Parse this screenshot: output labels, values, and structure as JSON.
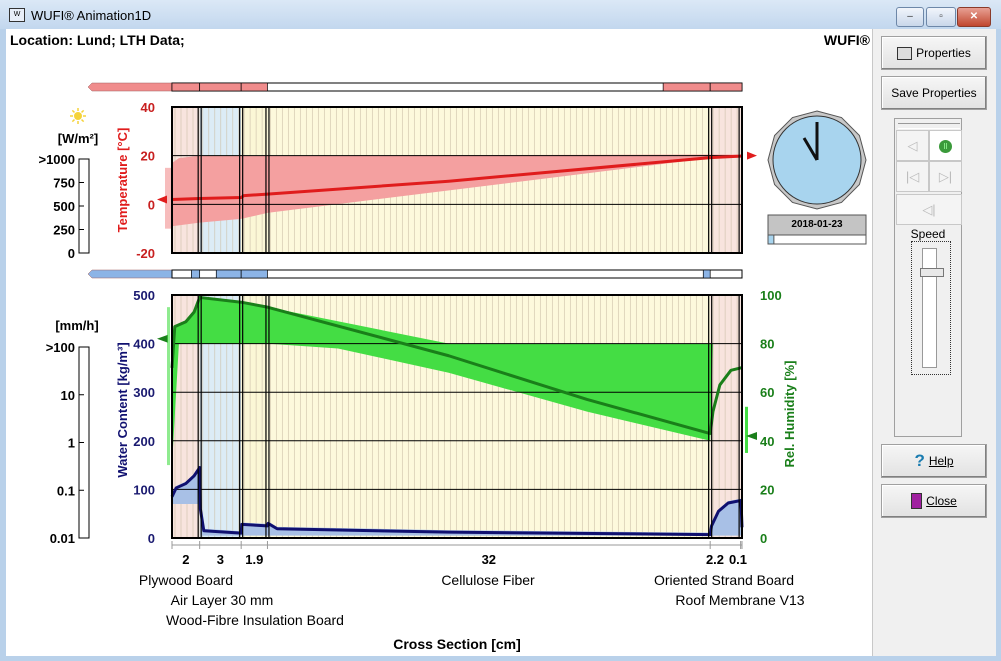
{
  "window": {
    "title": "WUFI® Animation1D",
    "icon": "wufi-app-icon",
    "minimize": "–",
    "maximize": "▫",
    "close": "✕"
  },
  "header": {
    "location": "Location: Lund; LTH Data;",
    "brand": "WUFI®"
  },
  "panel": {
    "properties": "Properties",
    "save_properties": "Save Properties",
    "speed_label": "Speed",
    "help": "Help",
    "close": "Close",
    "speed_level": 0.2,
    "playing": true
  },
  "clock": {
    "date": "2018-01-23",
    "hour_hand_time": "11:59",
    "progress": 0.06
  },
  "left_scales": {
    "radiation": {
      "unit": "[W/m²]",
      "ticks": [
        ">1000",
        "750",
        "500",
        "250",
        "0"
      ],
      "icon": "sun-icon",
      "value": 0
    },
    "rain": {
      "unit": "[mm/h]",
      "ticks": [
        ">100",
        "10",
        "1",
        "0.1",
        "0.01"
      ],
      "value": 0
    }
  },
  "colors": {
    "temperature": "#e01c1c",
    "water_content": "#101070",
    "rel_humidity": "#1a7f1a",
    "humidity_band": "#44dd44",
    "temp_band": "#f4a0a0",
    "wc_band": "#a8c0e6"
  },
  "chart_data": {
    "type": "line",
    "xlabel": "Cross Section [cm]",
    "layers": [
      {
        "name": "Plywood Board",
        "thickness": "2",
        "from": 0,
        "to": 2,
        "color": "#f8e4de"
      },
      {
        "name": "Air Layer 30 mm",
        "thickness": "3",
        "from": 2,
        "to": 5,
        "color": "#dcecf6"
      },
      {
        "name": "Wood-Fibre Insulation Board",
        "thickness": "1.9",
        "from": 5,
        "to": 6.9,
        "color": "#fbf7d6"
      },
      {
        "name": "Cellulose Fiber",
        "thickness": "32",
        "from": 6.9,
        "to": 38.9,
        "color": "#fdf9dc"
      },
      {
        "name": "Oriented Strand Board",
        "thickness": "2.2",
        "from": 38.9,
        "to": 41.1,
        "color": "#f8e4de"
      },
      {
        "name": "Roof Membrane V13",
        "thickness": "0.1",
        "from": 41.1,
        "to": 41.2,
        "color": "#f8e4de"
      }
    ],
    "temperature": {
      "ylabel": "Temperature [°C]",
      "ylim": [
        -20,
        40
      ],
      "ticks": [
        "40",
        "20",
        "0",
        "-20"
      ],
      "line": [
        [
          0,
          2
        ],
        [
          2,
          2.4
        ],
        [
          5,
          2.8
        ],
        [
          5.2,
          3.6
        ],
        [
          6.9,
          4.2
        ],
        [
          20,
          9.5
        ],
        [
          38.9,
          19.2
        ],
        [
          41.1,
          19.8
        ],
        [
          41.2,
          20
        ]
      ],
      "band_upper": [
        [
          0,
          17
        ],
        [
          0.5,
          19
        ],
        [
          2,
          20
        ],
        [
          41.2,
          20.5
        ]
      ],
      "band_lower": [
        [
          0,
          -9
        ],
        [
          2,
          -7.5
        ],
        [
          5,
          -6
        ],
        [
          6.9,
          -3.5
        ],
        [
          38.9,
          19
        ],
        [
          41.2,
          19.5
        ]
      ]
    },
    "water_content": {
      "ylabel": "Water Content [kg/m³]",
      "ylim": [
        0,
        500
      ],
      "ticks": [
        "500",
        "400",
        "300",
        "200",
        "100",
        "0"
      ],
      "line": [
        [
          0,
          85
        ],
        [
          0.3,
          103
        ],
        [
          1,
          112
        ],
        [
          1.6,
          128
        ],
        [
          2,
          145
        ],
        [
          2.05,
          60
        ],
        [
          2.3,
          15
        ],
        [
          5,
          10
        ],
        [
          5.05,
          28
        ],
        [
          6.9,
          25
        ],
        [
          6.95,
          30
        ],
        [
          7.6,
          19
        ],
        [
          20,
          12
        ],
        [
          38.9,
          7
        ],
        [
          39,
          25
        ],
        [
          39.5,
          55
        ],
        [
          40.2,
          72
        ],
        [
          41.1,
          77
        ],
        [
          41.15,
          60
        ],
        [
          41.2,
          22
        ]
      ],
      "band_lower": [
        [
          0,
          70
        ],
        [
          2,
          70
        ],
        [
          2.05,
          5
        ],
        [
          41.2,
          5
        ]
      ]
    },
    "rel_humidity": {
      "ylabel": "Rel. Humidity [%]",
      "ylim": [
        0,
        100
      ],
      "ticks": [
        "100",
        "80",
        "60",
        "40",
        "20",
        "0"
      ],
      "line": [
        [
          0,
          70
        ],
        [
          0.2,
          87
        ],
        [
          1,
          89
        ],
        [
          1.6,
          93
        ],
        [
          2,
          99
        ],
        [
          5,
          97
        ],
        [
          5.05,
          97
        ],
        [
          6.9,
          95
        ],
        [
          20,
          75
        ],
        [
          30,
          57
        ],
        [
          38.9,
          43
        ],
        [
          39.1,
          52
        ],
        [
          39.6,
          63
        ],
        [
          40.4,
          69
        ],
        [
          41.1,
          70
        ],
        [
          41.2,
          70
        ]
      ],
      "band_lower": [
        [
          0,
          30
        ],
        [
          0.5,
          80
        ],
        [
          6.9,
          80
        ],
        [
          12,
          78
        ],
        [
          20,
          68
        ],
        [
          30,
          52
        ],
        [
          38.9,
          40
        ],
        [
          39.1,
          80
        ],
        [
          41.2,
          80
        ]
      ]
    }
  }
}
